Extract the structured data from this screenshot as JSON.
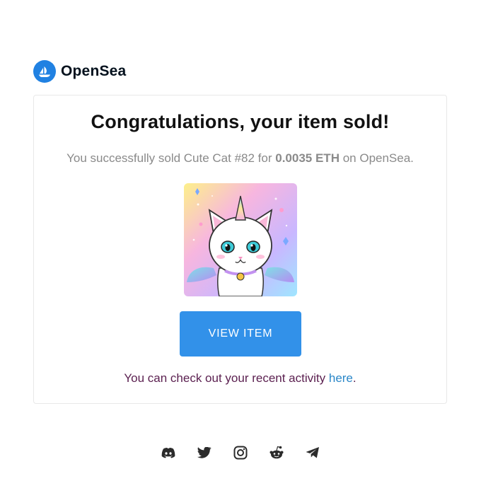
{
  "brand": {
    "name": "OpenSea",
    "logo_icon": "opensea-boat-icon",
    "logo_color": "#2081e2"
  },
  "card": {
    "title": "Congratulations, your item sold!",
    "message": {
      "prefix": "You successfully sold Cute Cat #82 for ",
      "price": "0.0035 ETH",
      "suffix": " on OpenSea."
    },
    "nft_image": "unicorn-cat-icon",
    "button_label": "VIEW ITEM",
    "button_color": "#3291e9",
    "activity": {
      "prefix": "You can check out your recent activity ",
      "link": "here",
      "suffix": "."
    }
  },
  "footer": {
    "socials": [
      "discord-icon",
      "twitter-icon",
      "instagram-icon",
      "reddit-icon",
      "telegram-icon"
    ]
  }
}
